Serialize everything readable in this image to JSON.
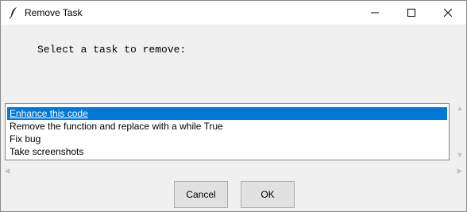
{
  "window": {
    "title": "Remove Task",
    "controls": {
      "minimize_icon": "minimize-icon",
      "maximize_icon": "maximize-icon",
      "close_icon": "close-icon"
    }
  },
  "prompt": {
    "label": "Select a task to remove:"
  },
  "task_list": {
    "items": [
      {
        "label": "Enhance this code",
        "selected": true
      },
      {
        "label": "Remove the function and replace with a while True",
        "selected": false
      },
      {
        "label": "Fix bug",
        "selected": false
      },
      {
        "label": "Take screenshots",
        "selected": false
      }
    ]
  },
  "scrollbars": {
    "vertical": {
      "up_icon": "arrow-up-icon",
      "down_icon": "arrow-down-icon"
    },
    "horizontal": {
      "left_icon": "arrow-left-icon",
      "right_icon": "arrow-right-icon"
    }
  },
  "buttons": {
    "cancel_label": "Cancel",
    "ok_label": "OK"
  },
  "colors": {
    "selection": "#0078d7",
    "window_background": "#f0f0f0",
    "titlebar_background": "#ffffff"
  }
}
